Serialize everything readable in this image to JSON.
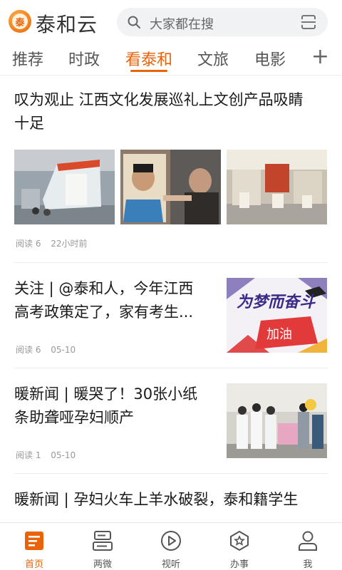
{
  "header": {
    "app_name": "泰和云",
    "logo_text": "泰",
    "search_placeholder": "大家都在搜"
  },
  "tabs": [
    {
      "label": "推荐"
    },
    {
      "label": "时政"
    },
    {
      "label": "看泰和",
      "active": true
    },
    {
      "label": "文旅"
    },
    {
      "label": "电影"
    }
  ],
  "add_tab_label": "+",
  "articles": [
    {
      "title_line1": "叹为观止 江西文化发展巡礼上文创产品吸睛",
      "title_line2": "十足",
      "reads": "阅读 6",
      "time": "22小时前"
    },
    {
      "title_line1": "关注 | @泰和人，今年江西",
      "title_line2": "高考政策定了，家有考生...",
      "reads": "阅读 6",
      "time": "05-10",
      "thumb_text_main": "为梦而奋斗",
      "thumb_text_sub": "加油"
    },
    {
      "title_line1": "暖新闻 | 暖哭了！30张小纸",
      "title_line2": "条助聋哑孕妇顺产",
      "reads": "阅读 1",
      "time": "05-10"
    },
    {
      "title_line1": "暖新闻 | 孕妇火车上羊水破裂，泰和籍学生"
    }
  ],
  "bottom_nav": [
    {
      "label": "首页",
      "active": true
    },
    {
      "label": "两微"
    },
    {
      "label": "视听"
    },
    {
      "label": "办事"
    },
    {
      "label": "我"
    }
  ],
  "colors": {
    "accent": "#e8630a",
    "text": "#1a1a1a",
    "meta": "#999999"
  }
}
